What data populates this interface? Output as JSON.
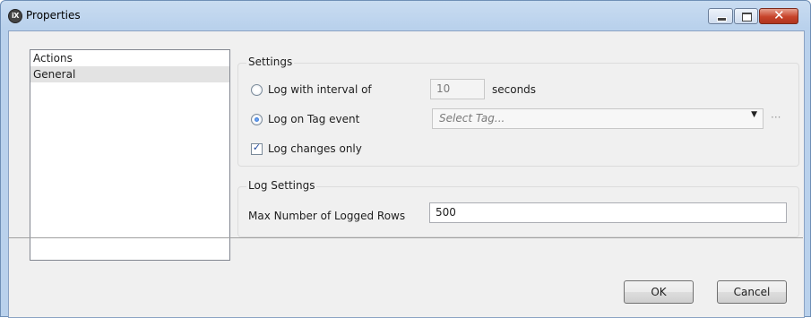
{
  "window": {
    "title": "Properties",
    "icon_text": "iX",
    "icon": "ix-app-icon",
    "caption_buttons": [
      "minimize-icon",
      "maximize-icon",
      "close-icon"
    ],
    "close_glyph": "✕"
  },
  "nav": {
    "items": [
      {
        "label": "Actions",
        "selected": false
      },
      {
        "label": "General",
        "selected": true
      }
    ]
  },
  "settings": {
    "group_label": "Settings",
    "log_interval": {
      "label": "Log with interval of",
      "checked": false,
      "value": "10",
      "unit": "seconds"
    },
    "log_tag": {
      "label": "Log on Tag event",
      "checked": true,
      "placeholder": "Select Tag...",
      "arrow": "▼",
      "browse": "···"
    },
    "log_changes": {
      "label": "Log changes only",
      "checked": true,
      "mark": "✓"
    }
  },
  "log_settings": {
    "group_label": "Log Settings",
    "max_rows_label": "Max Number of Logged Rows",
    "max_rows_value": "500"
  },
  "buttons": {
    "ok": "OK",
    "cancel": "Cancel"
  }
}
